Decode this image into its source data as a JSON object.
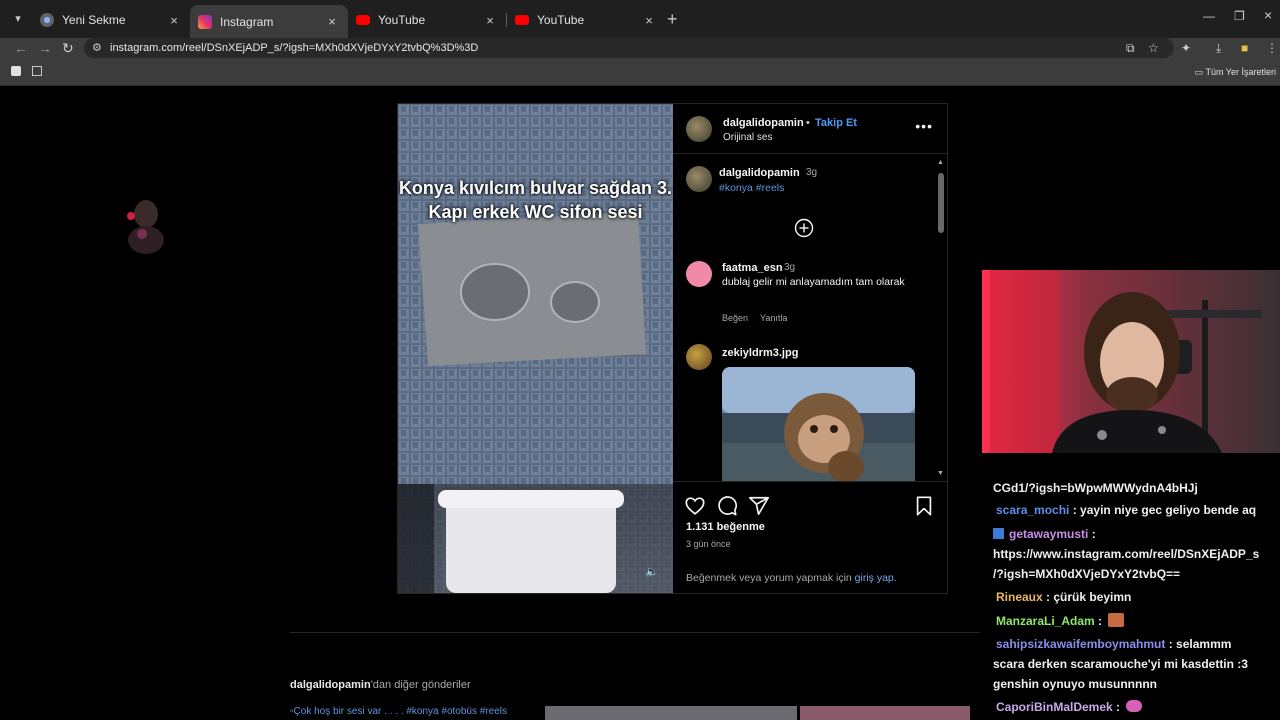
{
  "browser": {
    "tabs": [
      {
        "label": "Yeni Sekme",
        "active": false
      },
      {
        "label": "Instagram",
        "active": true
      },
      {
        "label": "YouTube",
        "active": false
      },
      {
        "label": "YouTube",
        "active": false
      }
    ],
    "url": "instagram.com/reel/DSnXEjADP_s/?igsh=MXh0dXVjeDYxY2tvbQ%3D%3D",
    "bookmarks_all": "Tüm Yer İşaretleri"
  },
  "post": {
    "video_caption": "Konya kıvılcım bulvar sağdan 3. Kapı erkek WC sifon sesi",
    "author": "dalgalidopamin",
    "separator": "•",
    "follow_label": "Takip Et",
    "audio": "Orijinal ses",
    "caption_time": "3g",
    "caption_tags": "#konya #reels",
    "comments": [
      {
        "user": "faatma_esn",
        "time": "3g",
        "text": "dublaj gelir mi anlayamadım tam olarak",
        "like_label": "Beğen",
        "reply_label": "Yanıtla"
      },
      {
        "user": "zekiyldrm3.jpg",
        "time": "",
        "text": ""
      }
    ],
    "likes": "1.131 beğenme",
    "posted_ago": "3 gün önce",
    "login_prompt": "Beğenmek veya yorum yapmak için",
    "login_link": "giriş yap."
  },
  "more_from": {
    "user": "dalgalidopamin",
    "suffix": "'dan diğer gönderiler",
    "thumb_alt": "Çok hoş bir sesi var . . . . #konya #otobüs #reels"
  },
  "chat": [
    {
      "user": "",
      "text": "CGd1/?igsh=bWpwMWWydnA4bHJj",
      "color": "#f0f0f0"
    },
    {
      "user": "scara_mochi",
      "text": " : yayin niye gec geliyo bende aq",
      "color": "#5b8fe8"
    },
    {
      "user": "getawaymusti",
      "text": " :",
      "color": "#c88ee8"
    },
    {
      "user": "",
      "text": "https://www.instagram.com/reel/DSnXEjADP_s",
      "color": "#f0f0f0"
    },
    {
      "user": "",
      "text": "/?igsh=MXh0dXVjeDYxY2tvbQ==",
      "color": "#f0f0f0"
    },
    {
      "user": "Rineaux",
      "text": " : çürük beyimn",
      "color": "#e8b860"
    },
    {
      "user": "ManzaraLi_Adam",
      "text": " :",
      "color": "#8ee86a"
    },
    {
      "user": "sahipsizkawaifemboymahmut",
      "text": " : selammm",
      "color": "#8a8ee8"
    },
    {
      "user": "",
      "text": "scara derken scaramouche'yi mi kasdettin :3",
      "color": "#f0f0f0"
    },
    {
      "user": "",
      "text": "genshin oynuyo musunnnnn",
      "color": "#f0f0f0"
    },
    {
      "user": "CaporiBinMalDemek",
      "text": " :",
      "color": "#c8a8e8"
    }
  ],
  "colors": {
    "accent": "#4f9bf8",
    "page_bg": "#000000",
    "tab_bar": "#1f1f1f",
    "toolbar": "#3c3c3c"
  }
}
